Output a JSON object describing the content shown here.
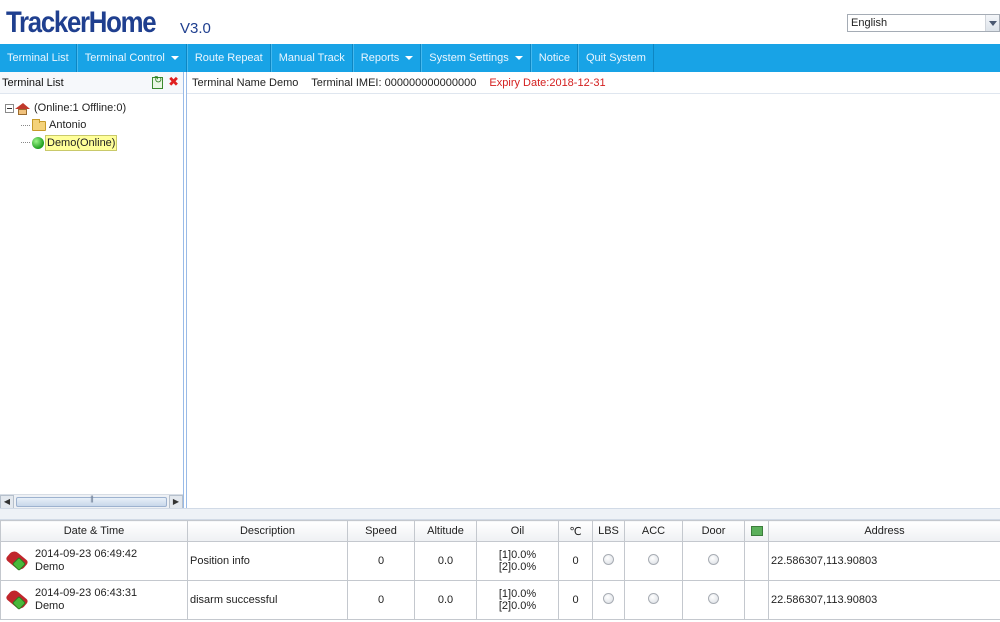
{
  "app": {
    "logo": "TrackerHome",
    "version": "V3.0",
    "language": "English"
  },
  "nav": [
    {
      "label": "Terminal List",
      "dropdown": false
    },
    {
      "label": "Terminal Control",
      "dropdown": true
    },
    {
      "label": "Route Repeat",
      "dropdown": false
    },
    {
      "label": "Manual Track",
      "dropdown": false
    },
    {
      "label": "Reports",
      "dropdown": true
    },
    {
      "label": "System Settings",
      "dropdown": true
    },
    {
      "label": "Notice",
      "dropdown": false
    },
    {
      "label": "Quit System",
      "dropdown": false
    }
  ],
  "sidebar": {
    "title": "Terminal List",
    "root_label": "(Online:1   Offline:0)",
    "items": [
      {
        "label": "Antonio",
        "icon": "folder-icon"
      },
      {
        "label": "Demo(Online)",
        "icon": "online-status-icon"
      }
    ]
  },
  "info_bar": {
    "terminal_name": "Terminal Name  Demo",
    "terminal_imei": "Terminal IMEI: 000000000000000",
    "expiry": "Expiry Date:2018-12-31",
    "expiry_color": "#d42020"
  },
  "table": {
    "headers": [
      "Date & Time",
      "Description",
      "Speed",
      "Altitude",
      "Oil",
      "℃",
      "LBS",
      "ACC",
      "Door",
      "",
      "Address"
    ],
    "rows": [
      {
        "datetime": "2014-09-23 06:49:42",
        "device": "Demo",
        "description": "Position info",
        "speed": "0",
        "altitude": "0.0",
        "oil1": "[1]0.0%",
        "oil2": "[2]0.0%",
        "temp": "0",
        "address": "22.586307,113.90803"
      },
      {
        "datetime": "2014-09-23 06:43:31",
        "device": "Demo",
        "description": "disarm successful",
        "speed": "0",
        "altitude": "0.0",
        "oil1": "[1]0.0%",
        "oil2": "[2]0.0%",
        "temp": "0",
        "address": "22.586307,113.90803"
      }
    ]
  },
  "colors": {
    "nav_bg": "#18a3e6",
    "logo": "#1f3f8f",
    "online_highlight": "#ffff99"
  }
}
